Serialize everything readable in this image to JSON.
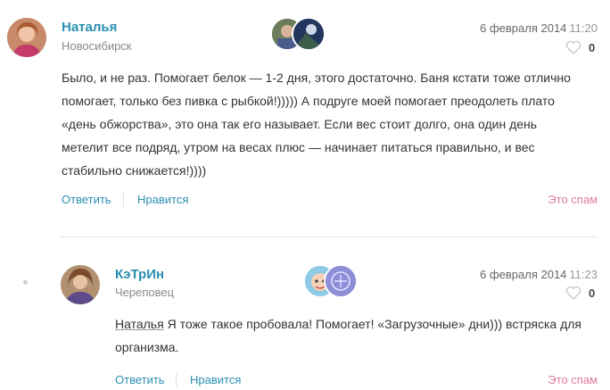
{
  "comments": [
    {
      "author": "Наталья",
      "city": "Новосибирск",
      "date": "6 февраля 2014",
      "time": "11:20",
      "likes": "0",
      "text": "Было, и не раз. Помогает белок — 1-2 дня, этого достаточно. Баня кстати тоже отлично помогает, только без пивка с рыбкой!))))) А подруге моей помогает преодолеть плато «день обжорства», это она так его называет. Если вес стоит долго, она один день метелит все подряд, утром на весах плюс — начинает питаться правильно, и вес стабильно снижается!))))",
      "reply_label": "Ответить",
      "like_label": "Нравится",
      "spam_label": "Это спам"
    },
    {
      "author": "КэТрИн",
      "city": "Череповец",
      "date": "6 февраля 2014",
      "time": "11:23",
      "likes": "0",
      "mention": "Наталья",
      "text": "Я тоже такое пробовала! Помогает! «Загрузочные» дни))) встряска для организма.",
      "reply_label": "Ответить",
      "like_label": "Нравится",
      "spam_label": "Это спам"
    }
  ],
  "colors": {
    "link": "#2a8fb0",
    "spam": "#e07aa0",
    "muted": "#8a8a8a"
  }
}
